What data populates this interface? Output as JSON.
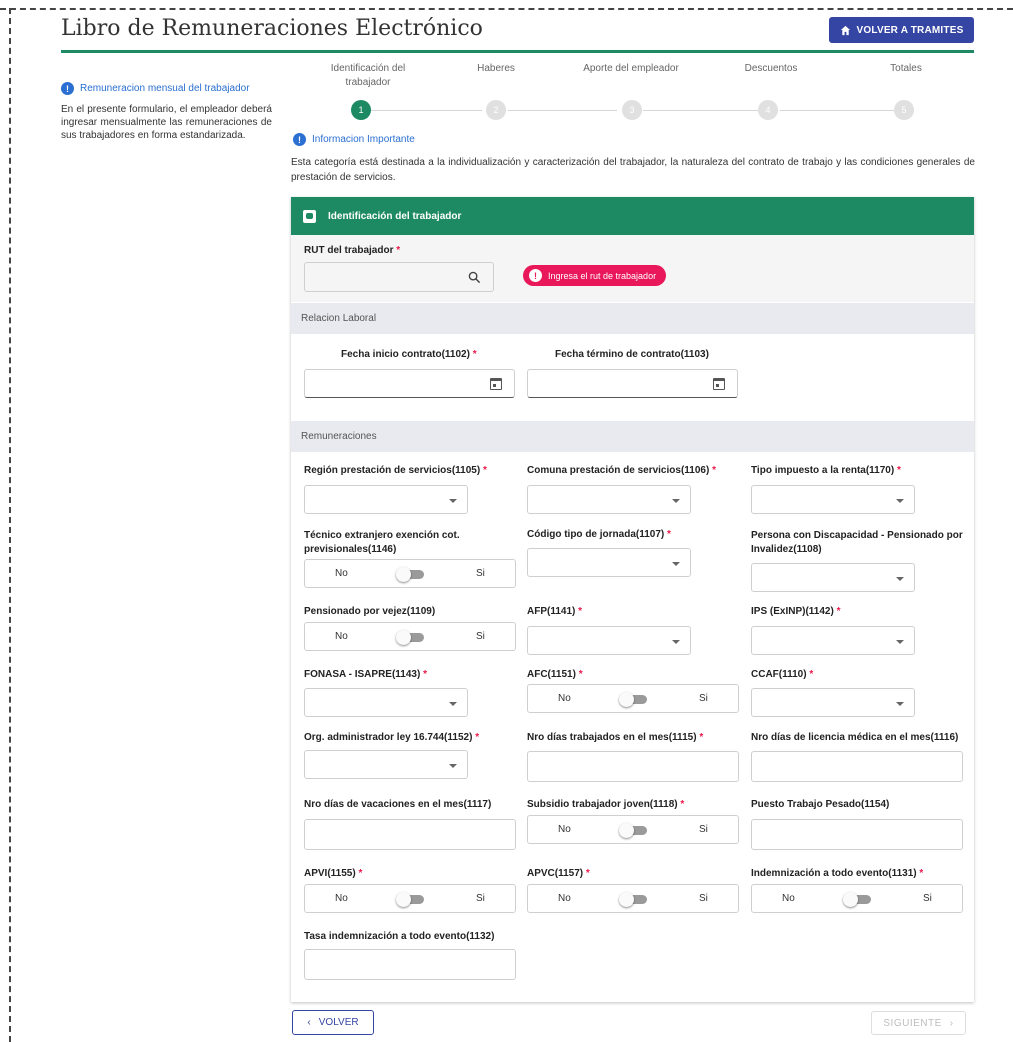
{
  "header": {
    "title": "Libro de Remuneraciones Electrónico",
    "back_button": "VOLVER A TRAMITES"
  },
  "sidebar": {
    "heading": "Remuneracion mensual del trabajador",
    "text": "En el presente formulario, el empleador deberá ingresar mensualmente las remuneraciones de sus trabajadores en forma estandarizada."
  },
  "stepper": {
    "steps": [
      {
        "label": "Identificación del trabajador",
        "number": "1",
        "active": true
      },
      {
        "label": "Haberes",
        "number": "2",
        "active": false
      },
      {
        "label": "Aporte del empleador",
        "number": "3",
        "active": false
      },
      {
        "label": "Descuentos",
        "number": "4",
        "active": false
      },
      {
        "label": "Totales",
        "number": "5",
        "active": false
      }
    ]
  },
  "info": {
    "heading": "Informacion Importante",
    "text": "Esta categoría está destinada a la individualización y caracterización del trabajador, la naturaleza del contrato de trabajo y las condiciones generales de prestación de servicios."
  },
  "card": {
    "title": "Identificación del trabajador",
    "rut": {
      "label": "RUT del trabajador",
      "required": "*",
      "value": "",
      "error": "Ingresa el rut de trabajador"
    },
    "relacion_laboral": {
      "title": "Relacion Laboral",
      "fecha_inicio": {
        "label": "Fecha inicio contrato(1102)",
        "required": "*",
        "value": ""
      },
      "fecha_termino": {
        "label": "Fecha término de contrato(1103)",
        "value": ""
      }
    },
    "remuneraciones": {
      "title": "Remuneraciones",
      "region": {
        "label": "Región prestación de servicios(1105)",
        "required": "*",
        "value": ""
      },
      "comuna": {
        "label": "Comuna prestación de servicios(1106)",
        "required": "*",
        "value": ""
      },
      "tipo_impuesto": {
        "label": "Tipo impuesto a la renta(1170)",
        "required": "*",
        "value": ""
      },
      "tecnico_extranjero": {
        "label": "Técnico extranjero exención cot. previsionales(1146)",
        "no": "No",
        "si": "Si"
      },
      "codigo_jornada": {
        "label": "Código tipo de jornada(1107)",
        "required": "*",
        "value": ""
      },
      "discapacidad": {
        "label": "Persona con Discapacidad - Pensionado por Invalidez(1108)",
        "value": ""
      },
      "pensionado_vejez": {
        "label": "Pensionado por vejez(1109)",
        "no": "No",
        "si": "Si"
      },
      "afp": {
        "label": "AFP(1141)",
        "required": "*",
        "value": ""
      },
      "ips": {
        "label": "IPS (ExINP)(1142)",
        "required": "*",
        "value": ""
      },
      "fonasa": {
        "label": "FONASA - ISAPRE(1143)",
        "required": "*",
        "value": ""
      },
      "afc": {
        "label": "AFC(1151)",
        "required": "*",
        "no": "No",
        "si": "Si"
      },
      "ccaf": {
        "label": "CCAF(1110)",
        "required": "*",
        "value": ""
      },
      "org_admin": {
        "label": "Org. administrador ley 16.744(1152)",
        "required": "*",
        "value": ""
      },
      "dias_trabajados": {
        "label": "Nro días trabajados en el mes(1115)",
        "required": "*",
        "value": ""
      },
      "dias_licencia": {
        "label": "Nro días de licencia médica en el mes(1116)",
        "value": ""
      },
      "dias_vacaciones": {
        "label": "Nro días de vacaciones en el mes(1117)",
        "value": ""
      },
      "subsidio_joven": {
        "label": "Subsidio trabajador joven(1118)",
        "required": "*",
        "no": "No",
        "si": "Si"
      },
      "puesto_pesado": {
        "label": "Puesto Trabajo Pesado(1154)",
        "value": ""
      },
      "apvi": {
        "label": "APVI(1155)",
        "required": "*",
        "no": "No",
        "si": "Si"
      },
      "apvc": {
        "label": "APVC(1157)",
        "required": "*",
        "no": "No",
        "si": "Si"
      },
      "indemnizacion": {
        "label": "Indemnización a todo evento(1131)",
        "required": "*",
        "no": "No",
        "si": "Si"
      },
      "tasa_indemnizacion": {
        "label": "Tasa indemnización a todo evento(1132)",
        "value": ""
      }
    }
  },
  "footer": {
    "back": "VOLVER",
    "next": "SIGUIENTE"
  },
  "colors": {
    "primary_green": "#1e8a63",
    "button_blue": "#3545a3",
    "info_blue": "#2a6fd1",
    "error_pink": "#e8185a"
  }
}
